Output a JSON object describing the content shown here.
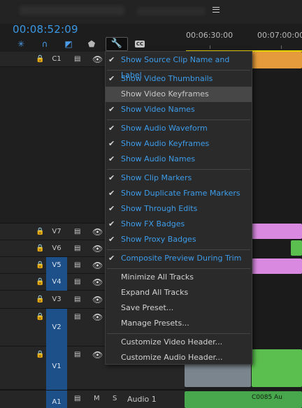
{
  "header": {
    "timecode": "00:08:52:09",
    "ruler_labels": [
      "00:06:30:00",
      "00:07:00:00"
    ]
  },
  "toolbar": {
    "cc_label": "CC",
    "icons": [
      "snap-icon",
      "magnet-icon",
      "linked-selection-icon",
      "marker-icon",
      "wrench-icon",
      "captions-icon"
    ]
  },
  "tracks": [
    {
      "name": "C1",
      "selected": false
    },
    {
      "name": "V7",
      "selected": false
    },
    {
      "name": "V6",
      "selected": false
    },
    {
      "name": "V5",
      "selected": true
    },
    {
      "name": "V4",
      "selected": true
    },
    {
      "name": "V3",
      "selected": false
    },
    {
      "name": "V2",
      "selected": true
    },
    {
      "name": "V1",
      "selected": true
    }
  ],
  "audio_track": {
    "name": "A1",
    "m": "M",
    "s": "S",
    "label": "Audio 1"
  },
  "clip_labels": {
    "audio_clip": "C0085 Au"
  },
  "menu": {
    "items": [
      {
        "label": "Show Source Clip Name and Label",
        "checked": true
      },
      {
        "label": "Show Video Thumbnails",
        "checked": true
      },
      {
        "label": "Show Video Keyframes",
        "checked": false,
        "hover": true
      },
      {
        "label": "Show Video Names",
        "checked": true
      },
      {
        "label": "Show Audio Waveform",
        "checked": true
      },
      {
        "label": "Show Audio Keyframes",
        "checked": true
      },
      {
        "label": "Show Audio Names",
        "checked": true
      },
      {
        "label": "Show Clip Markers",
        "checked": true
      },
      {
        "label": "Show Duplicate Frame Markers",
        "checked": true
      },
      {
        "label": "Show Through Edits",
        "checked": true
      },
      {
        "label": "Show FX Badges",
        "checked": true
      },
      {
        "label": "Show Proxy Badges",
        "checked": true
      },
      {
        "label": "Composite Preview During Trim",
        "checked": true
      },
      {
        "label": "Minimize All Tracks",
        "checked": false
      },
      {
        "label": "Expand All Tracks",
        "checked": false
      },
      {
        "label": "Save Preset...",
        "checked": false
      },
      {
        "label": "Manage Presets...",
        "checked": false
      },
      {
        "label": "Customize Video Header...",
        "checked": false
      },
      {
        "label": "Customize Audio Header...",
        "checked": false
      }
    ]
  },
  "colors": {
    "accent_blue": "#3d9cea",
    "track_select": "#1d4f88",
    "clip_orange": "#e59b3c",
    "clip_pink": "#d98ae0",
    "clip_green": "#5bbf4f",
    "playhead_yellow": "#e7d300"
  }
}
